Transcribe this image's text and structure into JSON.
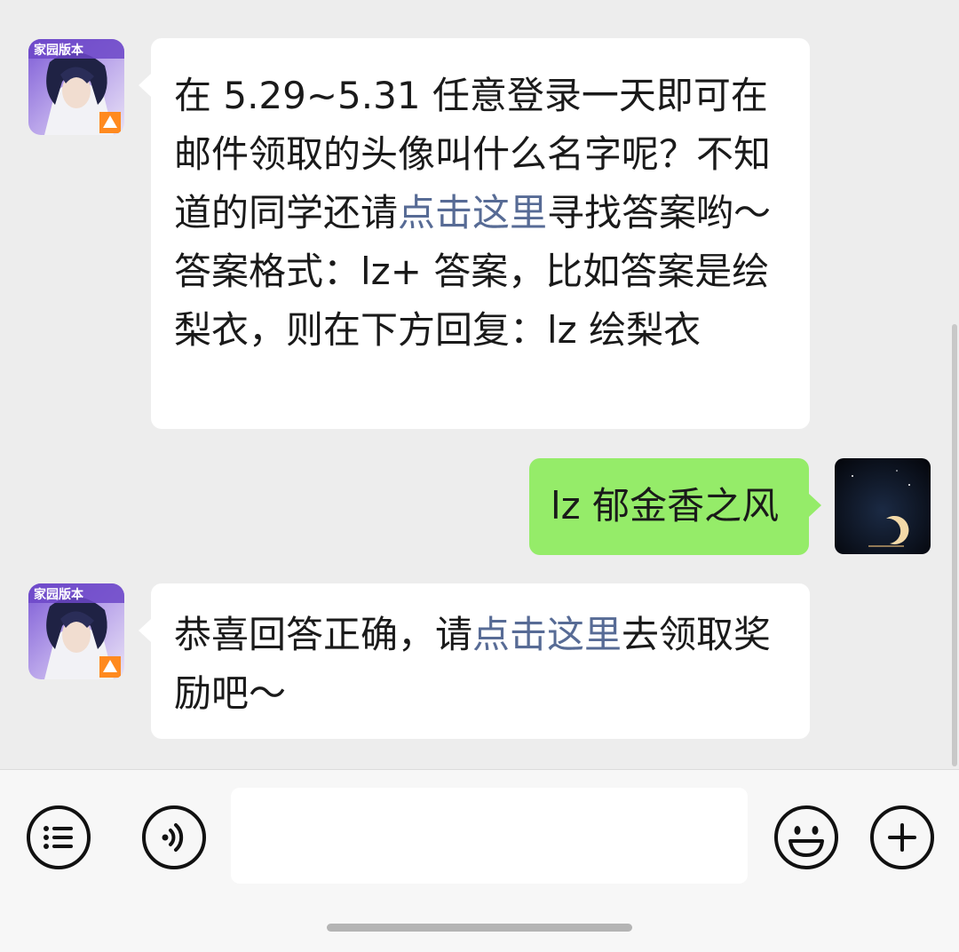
{
  "messages": [
    {
      "sender": "bot",
      "avatar_badge": "家园版本",
      "segments": [
        {
          "text": "在 5.29~5.31 任意登录一天即可在邮件领取的头像叫什么名字呢？不知道的同学还请",
          "link": false
        },
        {
          "text": "点击这里",
          "link": true
        },
        {
          "text": "寻找答案哟～",
          "link": false
        }
      ],
      "line2_prefix": "答案格式：lz+ 答案，比如答案是绘梨衣，则在下方回复：lz 绘梨衣"
    },
    {
      "sender": "me",
      "text": "lz 郁金香之风"
    },
    {
      "sender": "bot",
      "avatar_badge": "家园版本",
      "segments": [
        {
          "text": "恭喜回答正确，请",
          "link": false
        },
        {
          "text": "点击这里",
          "link": true
        },
        {
          "text": "去领取奖励吧～",
          "link": false
        }
      ]
    }
  ],
  "input": {
    "value": "",
    "placeholder": ""
  },
  "toolbar": {
    "menu_icon": "list-menu-icon",
    "voice_icon": "voice-icon",
    "emoji_icon": "emoji-icon",
    "plus_icon": "plus-icon"
  },
  "colors": {
    "chat_bg": "#ededed",
    "bubble_in": "#ffffff",
    "bubble_out": "#95ec69",
    "link": "#576b95",
    "toolbar_bg": "#f7f7f7"
  }
}
